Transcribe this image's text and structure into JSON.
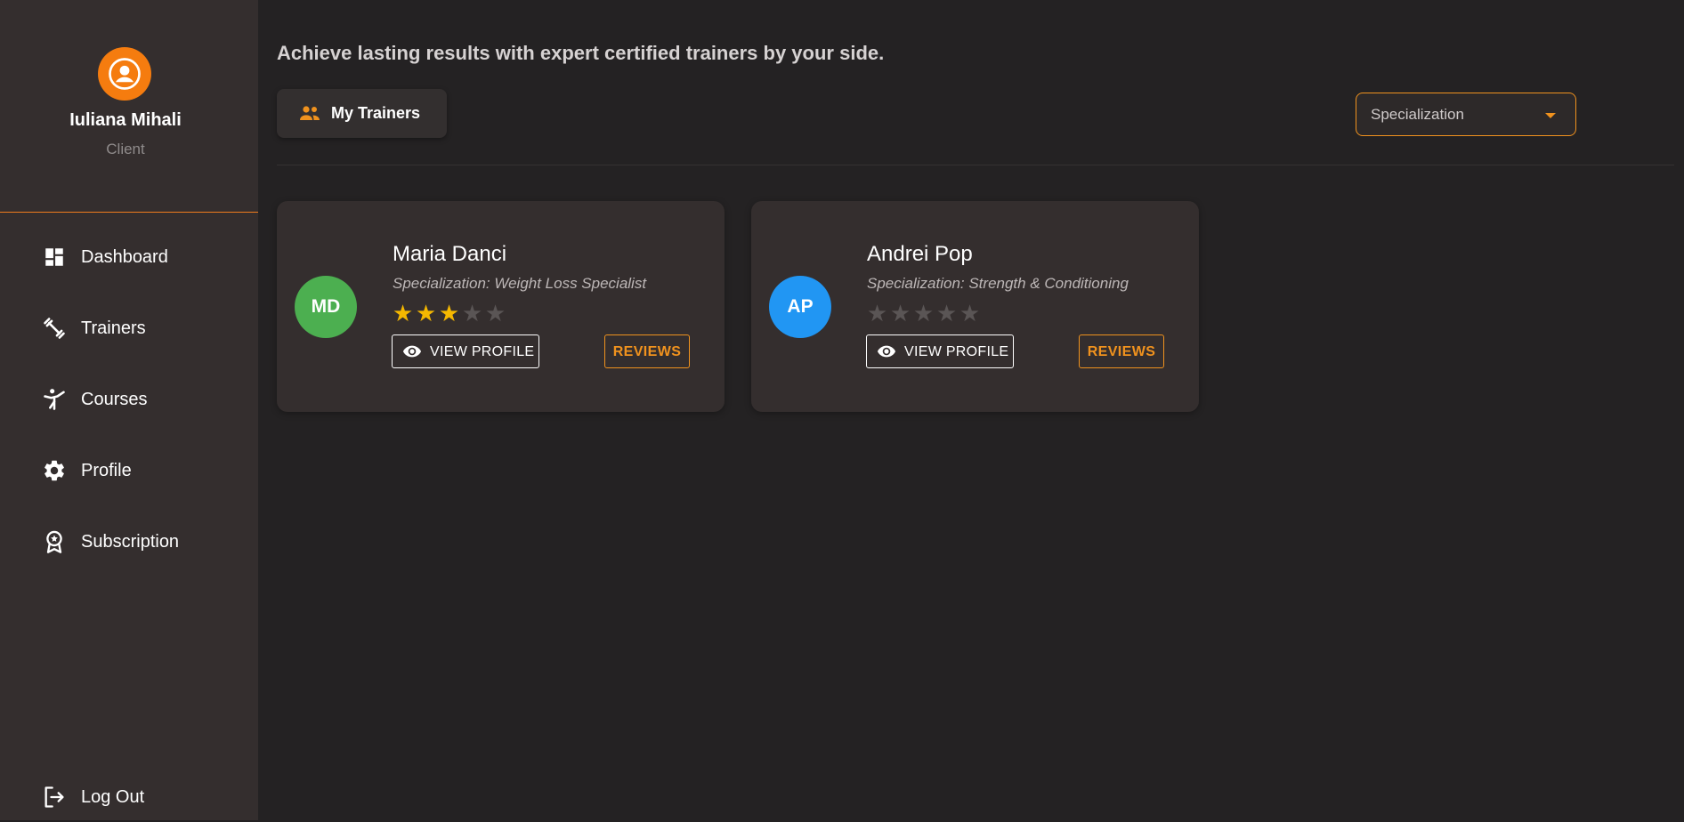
{
  "user": {
    "name": "Iuliana Mihali",
    "role": "Client",
    "avatar_icon": "account-circle-icon",
    "avatar_color": "#f57c0f"
  },
  "nav": {
    "items": [
      {
        "label": "Dashboard",
        "icon": "dashboard-icon"
      },
      {
        "label": "Trainers",
        "icon": "dumbbell-icon"
      },
      {
        "label": "Courses",
        "icon": "gymnastics-icon"
      },
      {
        "label": "Profile",
        "icon": "gear-icon"
      },
      {
        "label": "Subscription",
        "icon": "award-badge-icon"
      }
    ],
    "logout": {
      "label": "Log Out",
      "icon": "logout-icon"
    }
  },
  "header": {
    "headline": "Achieve lasting results with expert certified trainers by your side.",
    "my_trainers_label": "My Trainers",
    "my_trainers_icon": "people-icon",
    "filter_label": "Specialization"
  },
  "colors": {
    "accent": "#f0921e",
    "star_filled": "#f5b800",
    "star_empty": "#5a5555",
    "avatar_green": "#4caf50",
    "avatar_blue": "#2196f3"
  },
  "trainers": [
    {
      "initials": "MD",
      "name": "Maria Danci",
      "specialization": "Specialization: Weight Loss Specialist",
      "rating": 3,
      "max_rating": 5,
      "avatar_color": "#4caf50",
      "view_label": "VIEW PROFILE",
      "reviews_label": "REVIEWS"
    },
    {
      "initials": "AP",
      "name": "Andrei Pop",
      "specialization": "Specialization: Strength & Conditioning",
      "rating": 0,
      "max_rating": 5,
      "avatar_color": "#2196f3",
      "view_label": "VIEW PROFILE",
      "reviews_label": "REVIEWS"
    }
  ]
}
